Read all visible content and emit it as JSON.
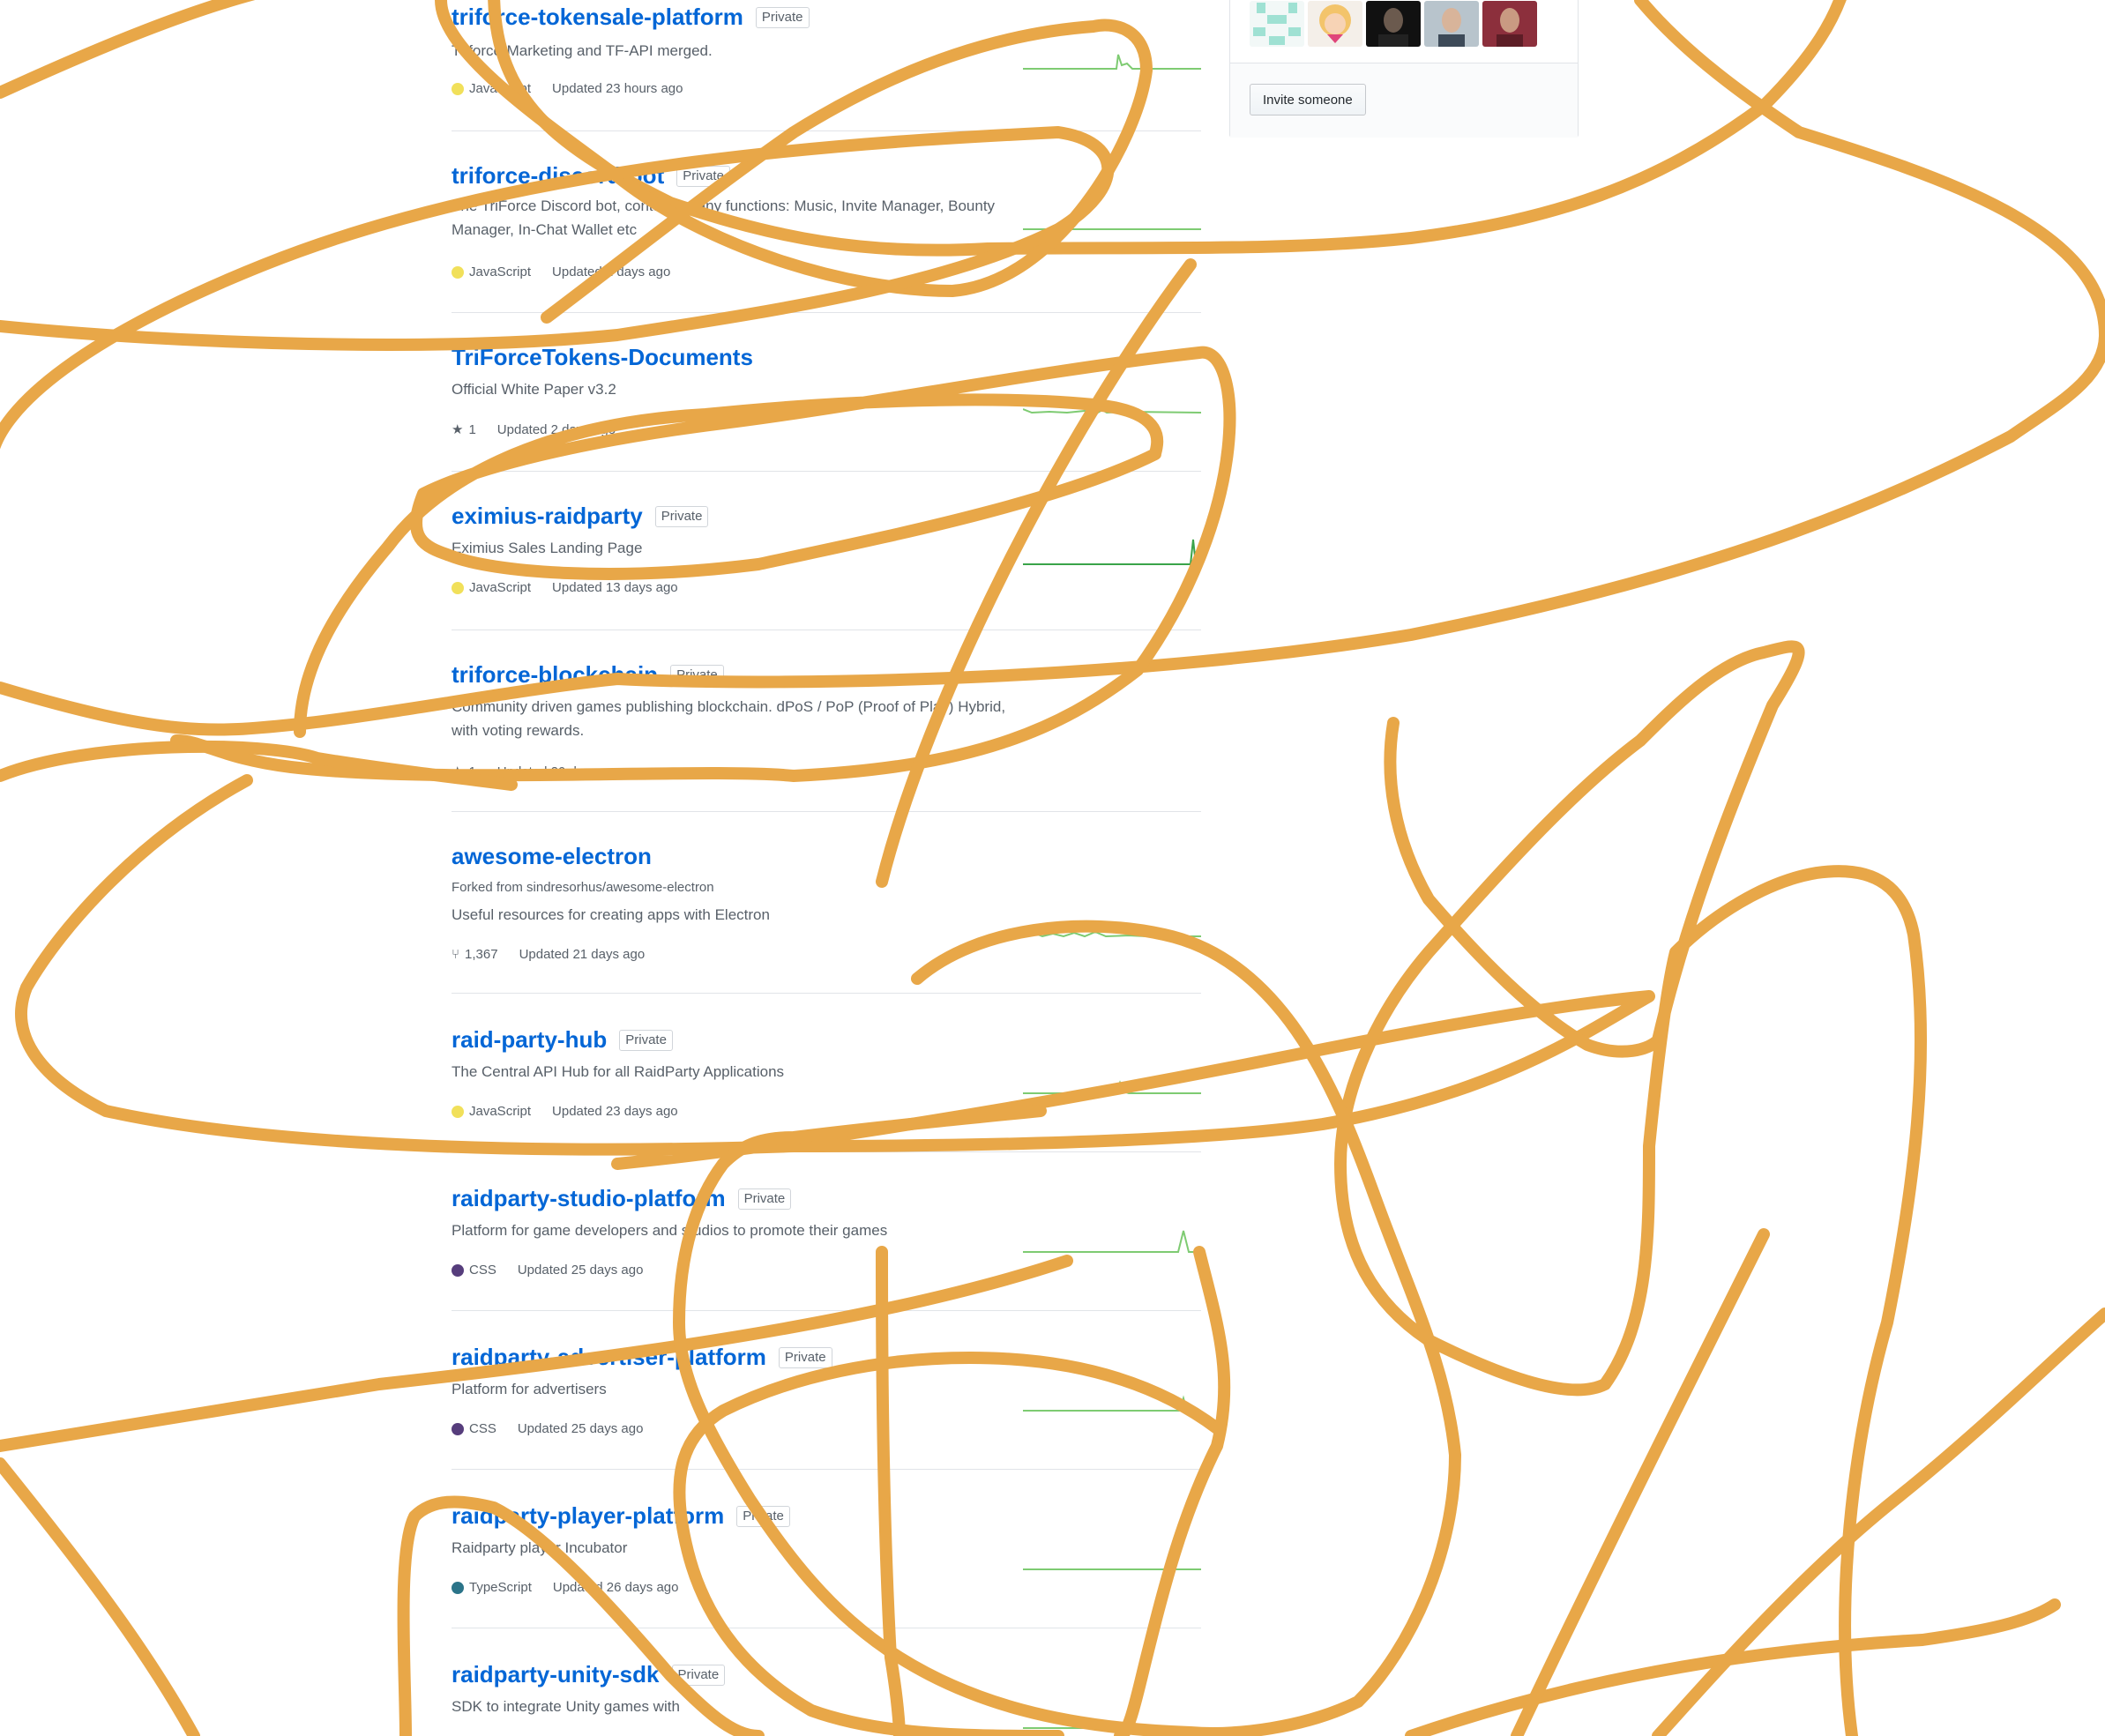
{
  "members": {
    "invite_label": "Invite someone"
  },
  "colors": {
    "link": "#0366d6",
    "muted": "#586069",
    "scribble": "#e8a748",
    "sparkline": "#7ecb72",
    "lang_javascript": "#f1e05a",
    "lang_css": "#563d7c",
    "lang_typescript": "#2b7489"
  },
  "repos": [
    {
      "name": "triforce-tokensale-platform",
      "badge": "Private",
      "description": "Triforce-Marketing and TF-API merged.",
      "language": "JavaScript",
      "updated": "Updated 23 hours ago"
    },
    {
      "name": "triforce-discord-bot",
      "badge": "Private",
      "description": "The TriForce Discord bot, contains many functions: Music, Invite Manager, Bounty Manager, In-Chat Wallet etc",
      "language": "JavaScript",
      "updated": "Updated 2 days ago"
    },
    {
      "name": "TriForceTokens-Documents",
      "description": "Official White Paper v3.2",
      "stars": "1",
      "updated": "Updated 2 days ago"
    },
    {
      "name": "eximius-raidparty",
      "badge": "Private",
      "description": "Eximius Sales Landing Page",
      "language": "JavaScript",
      "updated": "Updated 13 days ago"
    },
    {
      "name": "triforce-blockchain",
      "badge": "Private",
      "description": "Community driven games publishing blockchain. dPoS / PoP (Proof of Play) Hybrid, with voting rewards.",
      "stars": "1",
      "updated": "Updated 20 days ago"
    },
    {
      "name": "awesome-electron",
      "fork_note": "Forked from sindresorhus/awesome-electron",
      "description": "Useful resources for creating apps with Electron",
      "forks": "1,367",
      "updated": "Updated 21 days ago"
    },
    {
      "name": "raid-party-hub",
      "badge": "Private",
      "description": "The Central API Hub for all RaidParty Applications",
      "language": "JavaScript",
      "updated": "Updated 23 days ago"
    },
    {
      "name": "raidparty-studio-platform",
      "badge": "Private",
      "description": "Platform for game developers and studios to promote their games",
      "language": "CSS",
      "updated": "Updated 25 days ago"
    },
    {
      "name": "raidparty-advertiser-platform",
      "badge": "Private",
      "description": "Platform for advertisers",
      "language": "CSS",
      "updated": "Updated 25 days ago"
    },
    {
      "name": "raidparty-player-platform",
      "badge": "Private",
      "description": "Raidparty player Incubator",
      "language": "TypeScript",
      "updated": "Updated 26 days ago"
    },
    {
      "name": "raidparty-unity-sdk",
      "badge": "Private",
      "description": "SDK to integrate Unity games with"
    }
  ]
}
